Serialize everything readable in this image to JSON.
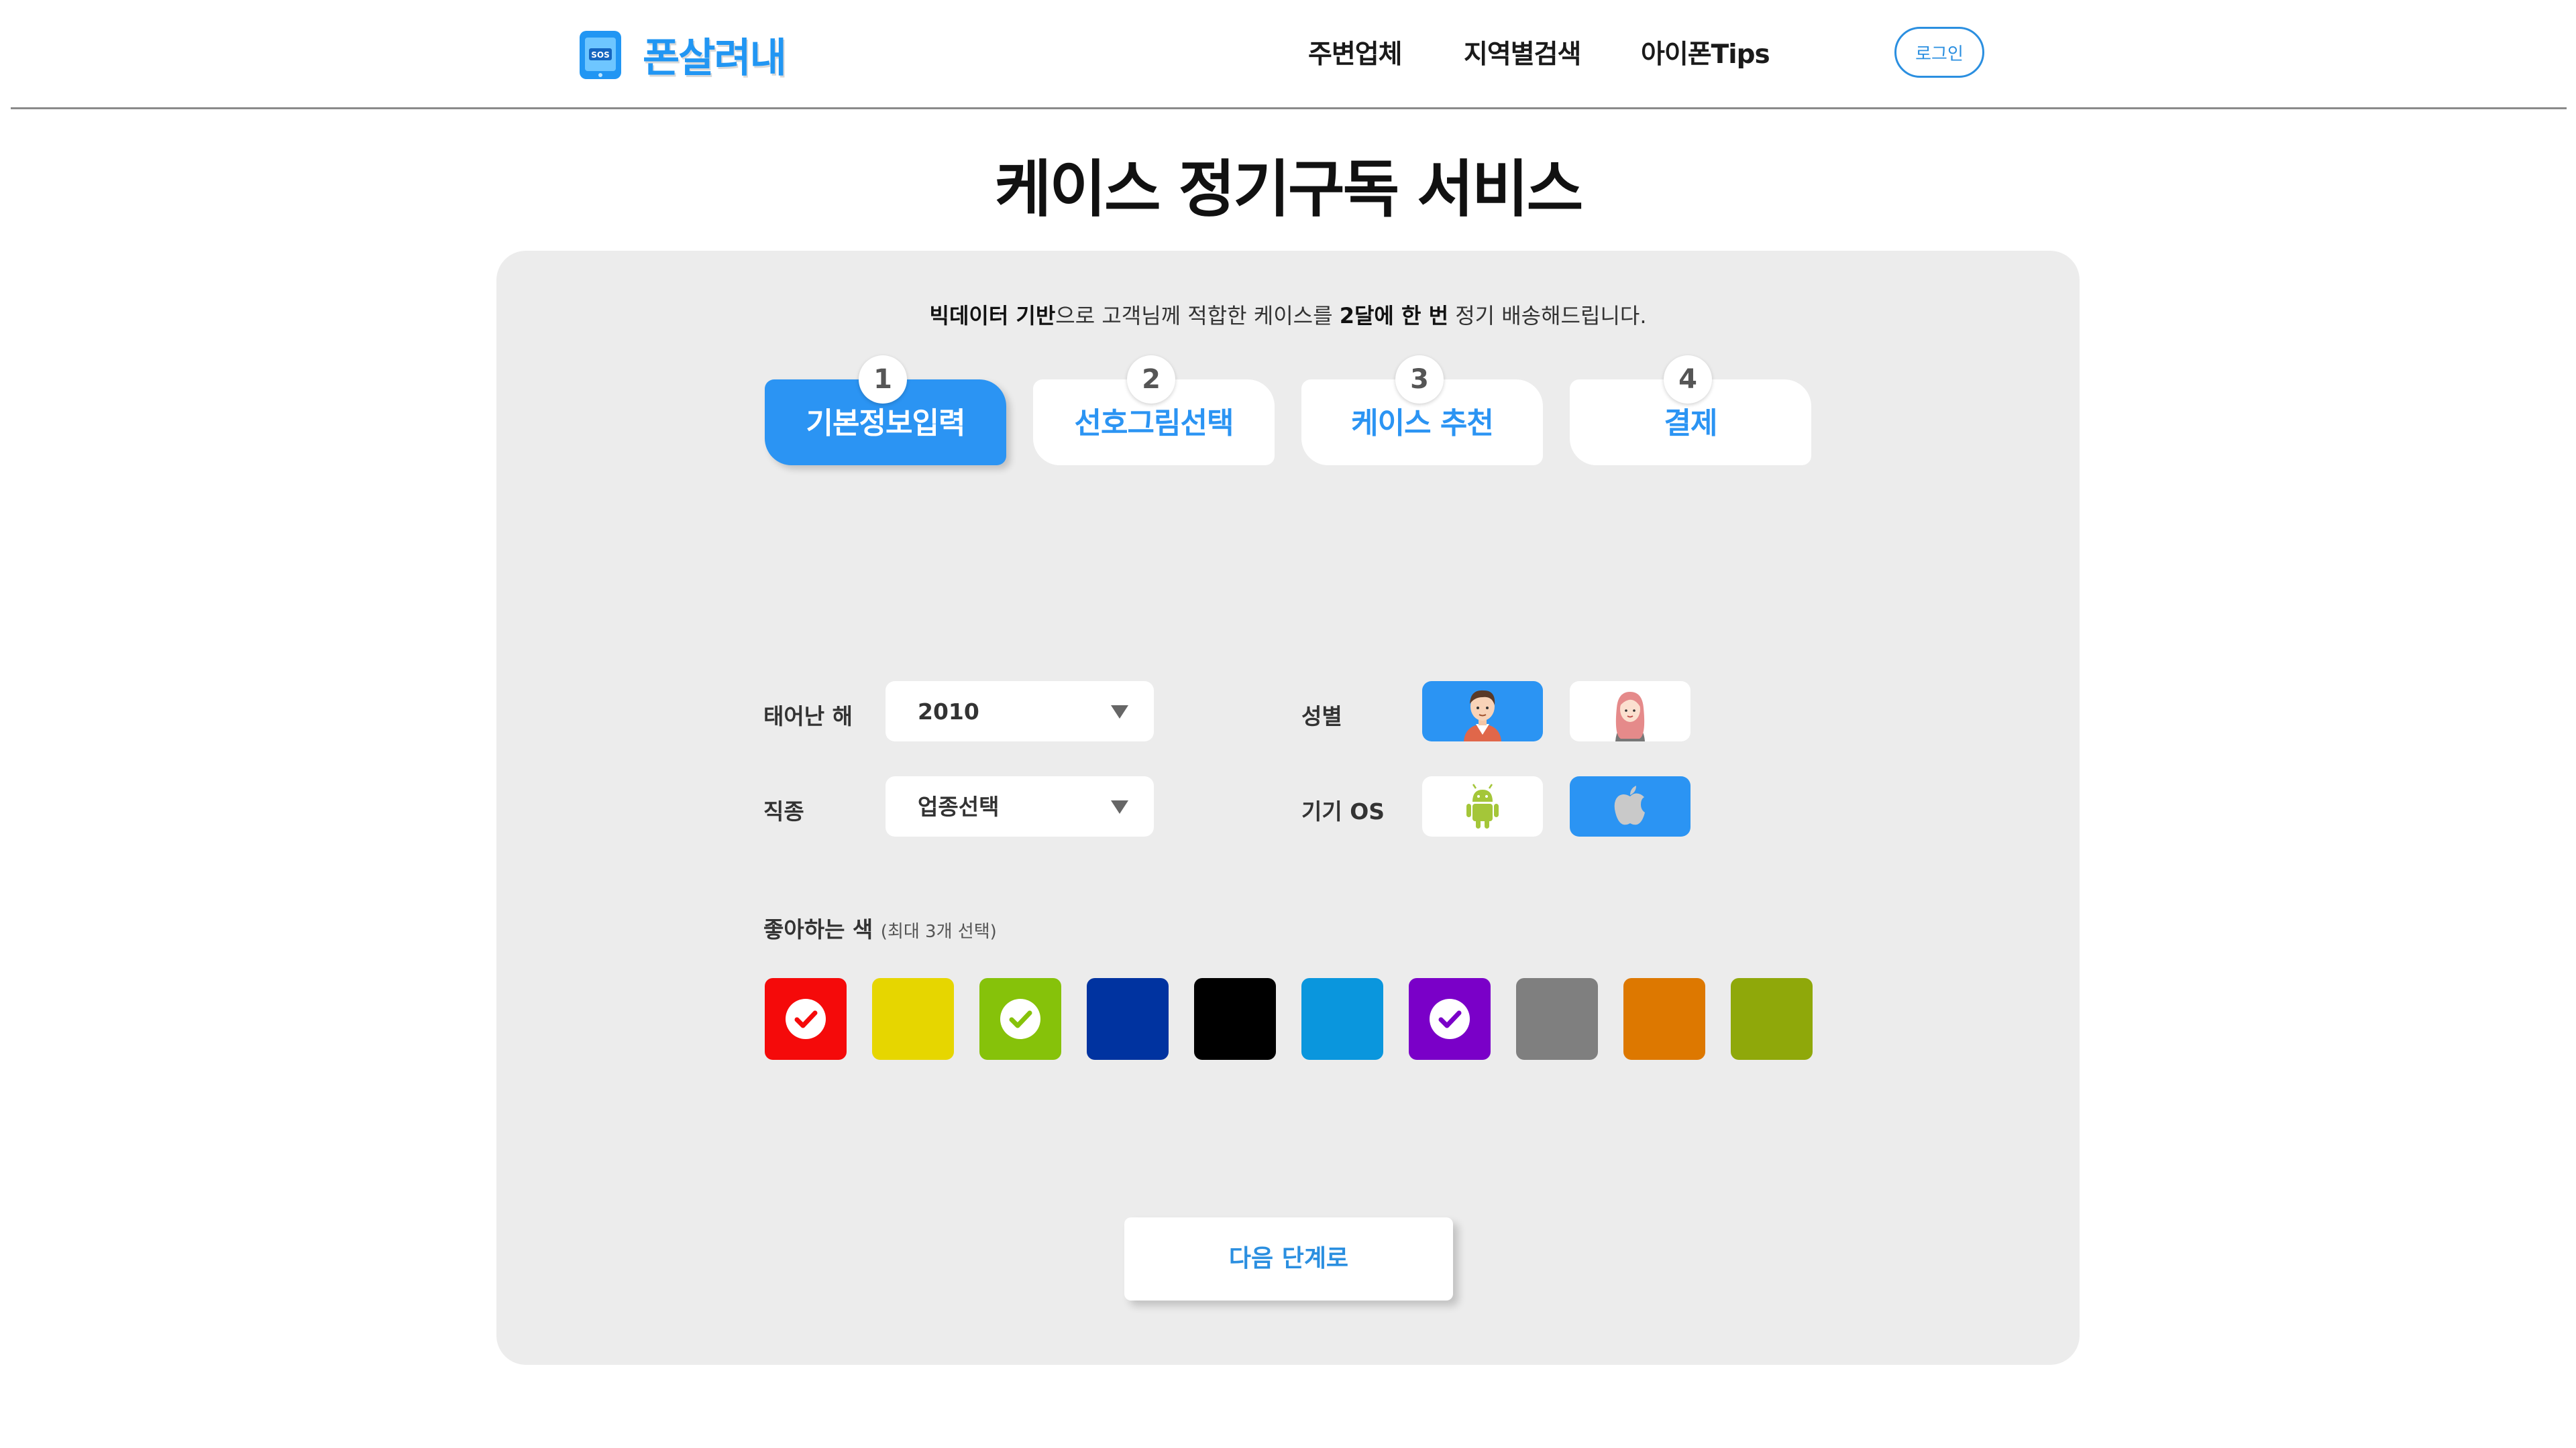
{
  "header": {
    "logo_text": "폰살려내",
    "nav": [
      "주변업체",
      "지역별검색",
      "아이폰Tips"
    ],
    "login_label": "로그인"
  },
  "page_title": "케이스 정기구독 서비스",
  "intro": {
    "part1_bold": "빅데이터 기반",
    "part2": "으로 고객님께 적합한 케이스를 ",
    "part3_bold": "2달에 한 번",
    "part4": " 정기 배송해드립니다."
  },
  "steps": [
    {
      "num": "1",
      "label": "기본정보입력",
      "active": true
    },
    {
      "num": "2",
      "label": "선호그림선택",
      "active": false
    },
    {
      "num": "3",
      "label": "케이스 추천",
      "active": false
    },
    {
      "num": "4",
      "label": "결제",
      "active": false
    }
  ],
  "form": {
    "birth_year_label": "태어난 해",
    "birth_year_value": "2010",
    "job_label": "직종",
    "job_value": "업종선택",
    "gender_label": "성별",
    "gender_selected": "male",
    "os_label": "기기 OS",
    "os_selected": "ios"
  },
  "colors": {
    "label": "좋아하는 색",
    "hint": "(최대 3개 선택)",
    "swatches": [
      {
        "hex": "#f50a0a",
        "selected": true
      },
      {
        "hex": "#e6d600",
        "selected": false
      },
      {
        "hex": "#86c20a",
        "selected": true
      },
      {
        "hex": "#0033a0",
        "selected": false
      },
      {
        "hex": "#000000",
        "selected": false
      },
      {
        "hex": "#0a96dd",
        "selected": false
      },
      {
        "hex": "#7a00c8",
        "selected": true
      },
      {
        "hex": "#7f7f7f",
        "selected": false
      },
      {
        "hex": "#dd7800",
        "selected": false
      },
      {
        "hex": "#8fa80a",
        "selected": false
      }
    ]
  },
  "next_label": "다음 단계로",
  "accent": "#2b94f3"
}
